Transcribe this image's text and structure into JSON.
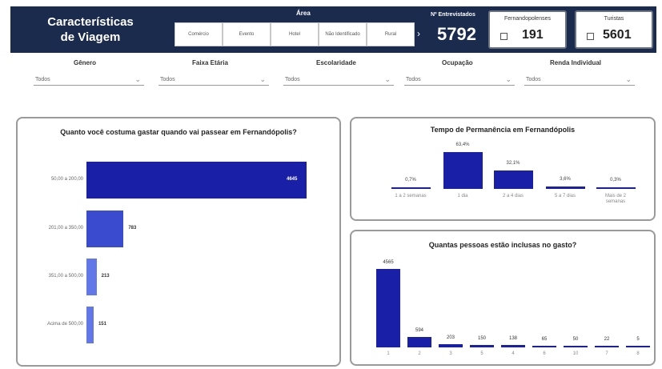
{
  "header": {
    "title_line1": "Características",
    "title_line2": "de Viagem",
    "area_label": "Área",
    "area_buttons": [
      "Comércio",
      "Evento",
      "Hotel",
      "Não Identificado",
      "Rural"
    ],
    "entrevistados_label": "Nº Entrevistados",
    "entrevistados_value": "5792",
    "cards": [
      {
        "label": "Fernandopolenses",
        "value": "191"
      },
      {
        "label": "Turistas",
        "value": "5601"
      }
    ]
  },
  "filters": [
    {
      "label": "Gênero",
      "value": "Todos"
    },
    {
      "label": "Faixa Etária",
      "value": "Todos"
    },
    {
      "label": "Escolaridade",
      "value": "Todos"
    },
    {
      "label": "Ocupação",
      "value": "Todos"
    },
    {
      "label": "Renda Individual",
      "value": "Todos"
    }
  ],
  "colors": {
    "header_bg": "#1a2b4d",
    "bar_dark": "#1a1fa8",
    "bar_medium": "#3a4bd0",
    "bar_light": "#6278e8"
  },
  "chart_data": [
    {
      "type": "bar",
      "orientation": "horizontal",
      "title": "Quanto você costuma gastar quando vai passear em Fernandópolis?",
      "categories": [
        "50,00 a 200,00",
        "201,00 a 350,00",
        "351,00 a 500,00",
        "Acima de 500,00"
      ],
      "values": [
        4645,
        783,
        213,
        151
      ],
      "value_labels": [
        "4645",
        "783",
        "213",
        "151"
      ]
    },
    {
      "type": "bar",
      "title": "Tempo de Permanência em Fernandópolis",
      "categories": [
        "1 a 2 semanas",
        "1 dia",
        "2 a 4 dias",
        "5 a 7 dias",
        "Mais de 2 semanas"
      ],
      "values": [
        0.7,
        63.4,
        32.1,
        3.6,
        0.3
      ],
      "value_labels": [
        "0,7%",
        "63,4%",
        "32,1%",
        "3,6%",
        "0,3%"
      ]
    },
    {
      "type": "bar",
      "title": "Quantas pessoas estão inclusas no gasto?",
      "categories": [
        "1",
        "2",
        "3",
        "5",
        "4",
        "6",
        "10",
        "7",
        "8"
      ],
      "values": [
        4565,
        594,
        203,
        150,
        138,
        65,
        50,
        22,
        5
      ],
      "value_labels": [
        "4565",
        "594",
        "203",
        "150",
        "138",
        "65",
        "50",
        "22",
        "5"
      ]
    }
  ]
}
